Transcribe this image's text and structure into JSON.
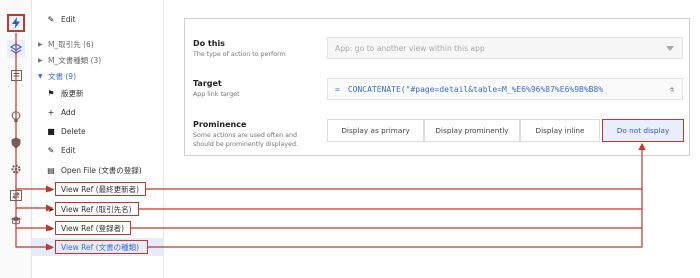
{
  "rail": {
    "icons": [
      "lightning-icon",
      "layers-icon",
      "list-icon",
      "bulb-icon",
      "shield-icon",
      "gear-icon",
      "swap-icon",
      "graduation-icon"
    ]
  },
  "tree": {
    "items": [
      {
        "label": "Edit",
        "icon": "✎"
      },
      {
        "label": "M_取引先 (6)"
      },
      {
        "label": "M_文書種類 (3)"
      },
      {
        "label": "文書 (9)"
      },
      {
        "label": "版更新",
        "icon": "⚑"
      },
      {
        "label": "Add",
        "icon": "+"
      },
      {
        "label": "Delete",
        "icon": "■"
      },
      {
        "label": "Edit",
        "icon": "✎"
      },
      {
        "label": "Open File (文書の登録)",
        "icon": "▤"
      },
      {
        "label": "View Ref (最終更新者)",
        "icon": "➤"
      },
      {
        "label": "View Ref (取引先名)",
        "icon": "➤"
      },
      {
        "label": "View Ref (登録者)",
        "icon": "➤"
      },
      {
        "label": "View Ref (文書の種類)",
        "icon": "➤"
      }
    ]
  },
  "settings": {
    "do_this": {
      "label": "Do this",
      "sub": "The type of action to perform",
      "value": "App: go to another view within this app"
    },
    "target": {
      "label": "Target",
      "sub": "App link target",
      "prefix": "=",
      "value": "CONCATENATE(\"#page=detail&table=M_%E6%96%87%E6%9B%B8%",
      "trail_icon": "⚗"
    },
    "prominence": {
      "label": "Prominence",
      "sub_line1": "Some actions are used often and",
      "sub_line2": "should be prominently displayed.",
      "options": [
        "Display as primary",
        "Display prominently",
        "Display inline",
        "Do not display"
      ],
      "selected": "Do not display"
    }
  },
  "colors": {
    "annotation_red": "#c0392b",
    "accent_blue": "#3b6fd3",
    "highlight_bg": "#e6ecfa"
  }
}
